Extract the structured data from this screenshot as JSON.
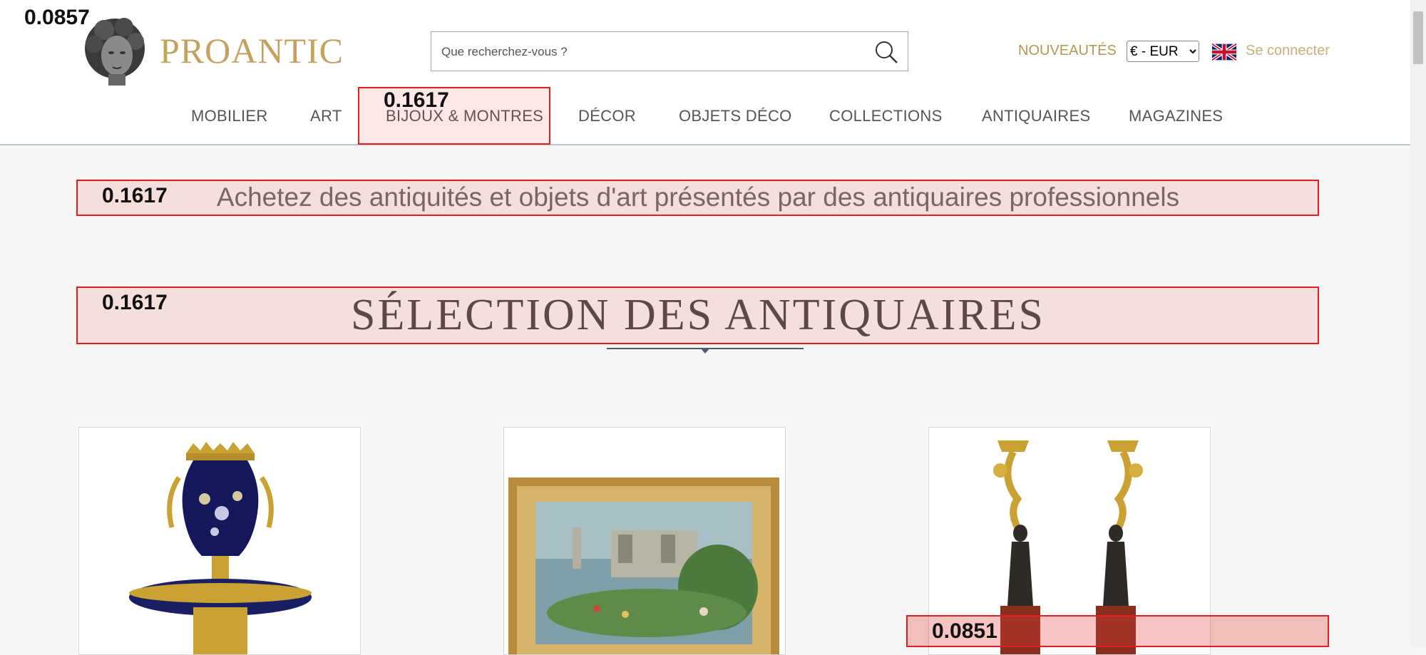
{
  "header": {
    "logo_text": "PROANTIC",
    "search": {
      "placeholder": "Que recherchez-vous ?"
    },
    "nouveautes_label": "NOUVEAUTÉS",
    "currency": {
      "selected": "€ - EUR"
    },
    "language_flag": "uk-flag-icon",
    "connect_label": "Se connecter",
    "colors": {
      "brand_gold": "#c4a15d",
      "link_gold": "#b5984f"
    }
  },
  "nav": {
    "items": [
      {
        "label": "MOBILIER"
      },
      {
        "label": "ART"
      },
      {
        "label": "BIJOUX & MONTRES"
      },
      {
        "label": "DÉCOR"
      },
      {
        "label": "OBJETS DÉCO"
      },
      {
        "label": "COLLECTIONS"
      },
      {
        "label": "ANTIQUAIRES"
      },
      {
        "label": "MAGAZINES"
      }
    ]
  },
  "main": {
    "tagline": "Achetez des antiquités et objets d'art présentés par des antiquaires professionnels",
    "section_title": "SÉLECTION DES ANTIQUAIRES",
    "products": [
      {
        "image": "vase-image"
      },
      {
        "image": "painting-image"
      },
      {
        "image": "candelabra-image"
      }
    ]
  },
  "annotations": {
    "top_left_score": "0.0857",
    "nav_score": "0.1617",
    "tagline_score": "0.1617",
    "title_score": "0.1617",
    "card_score": "0.0851"
  }
}
